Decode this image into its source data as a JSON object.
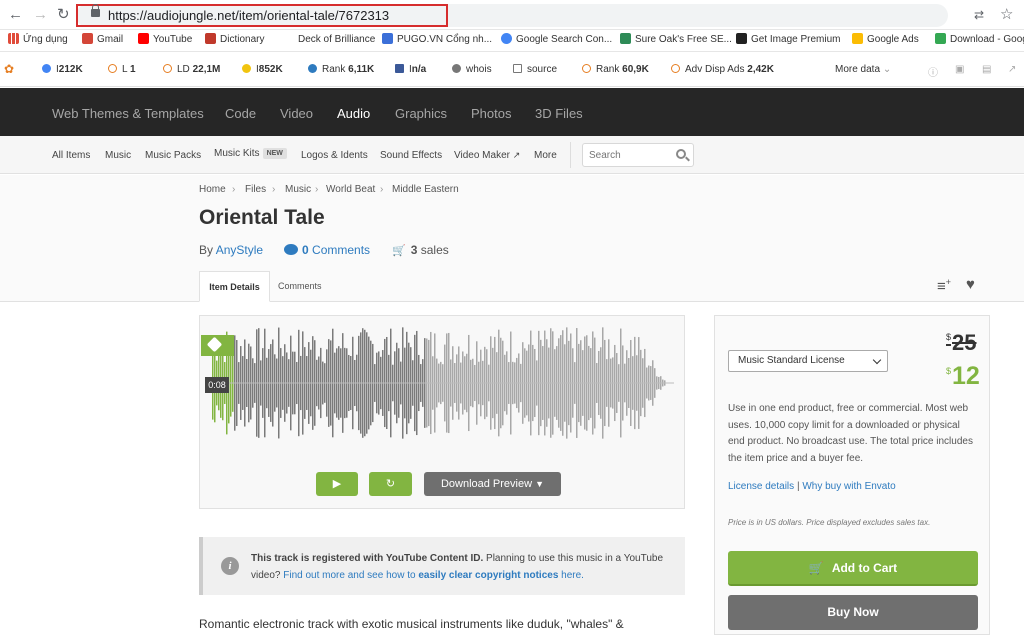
{
  "browser": {
    "url": "https://audiojungle.net/item/oriental-tale/7672313"
  },
  "bookmarks": [
    {
      "label": "Ứng dụng",
      "color": "#e04b3a"
    },
    {
      "label": "Gmail",
      "color": "#d44638"
    },
    {
      "label": "YouTube",
      "color": "#ff0000"
    },
    {
      "label": "Dictionary",
      "color": "#c0392b"
    },
    {
      "label": "Deck of Brilliance",
      "color": "#ffffff"
    },
    {
      "label": "PUGO.VN Cổng nh...",
      "color": "#3b6fd8"
    },
    {
      "label": "Google Search Con...",
      "color": "#4285f4"
    },
    {
      "label": "Sure Oak's Free SE...",
      "color": "#2e8b57"
    },
    {
      "label": "Get Image Premium",
      "color": "#222222"
    },
    {
      "label": "Google Ads",
      "color": "#fbbc04"
    },
    {
      "label": "Download - Goog",
      "color": "#34a853"
    }
  ],
  "seo_toolbar": [
    {
      "prefix": "I",
      "value": "212K",
      "color": "#4285f4"
    },
    {
      "prefix": "L",
      "value": "1",
      "color": "#e67e22"
    },
    {
      "prefix": "LD",
      "value": "22,1M",
      "color": "#e67e22"
    },
    {
      "prefix": "I",
      "value": "852K",
      "color": "#f1c40f"
    },
    {
      "prefix": "Rank",
      "value": "6,11K",
      "color": "#2e7bbf"
    },
    {
      "prefix": "I",
      "value": "n/a",
      "color": "#3b5998"
    },
    {
      "prefix": "whois",
      "value": "",
      "color": "#777777"
    },
    {
      "prefix": "source",
      "value": "",
      "color": "#777777"
    },
    {
      "prefix": "Rank",
      "value": "60,9K",
      "color": "#e67e22"
    },
    {
      "prefix": "Adv Disp Ads",
      "value": "2,42K",
      "color": "#e67e22"
    }
  ],
  "seo_more": "More data",
  "top_nav": [
    "Web Themes & Templates",
    "Code",
    "Video",
    "Audio",
    "Graphics",
    "Photos",
    "3D Files"
  ],
  "sub_nav": {
    "items": [
      "All Items",
      "Music",
      "Music Packs",
      "Music Kits",
      "Logos & Idents",
      "Sound Effects",
      "Video Maker",
      "More"
    ],
    "new_badge": "NEW",
    "search_placeholder": "Search"
  },
  "breadcrumb": [
    "Home",
    "Files",
    "Music",
    "World Beat",
    "Middle Eastern"
  ],
  "item": {
    "title": "Oriental Tale",
    "by": "By",
    "author": "AnyStyle",
    "comments_count": "0",
    "comments_label": "Comments",
    "sales_count": "3",
    "sales_label": "sales"
  },
  "tabs": [
    "Item Details",
    "Comments"
  ],
  "player": {
    "time": "0:08",
    "progress": 0.46,
    "download_label": "Download Preview"
  },
  "notice": {
    "bold": "This track is registered with YouTube Content ID.",
    "text": " Planning to use this music in a YouTube video? ",
    "link1": "Find out more and see how to ",
    "link_bold": "easily clear copyright notices",
    "link2": " here."
  },
  "description": "Romantic electronic track with exotic musical instruments like duduk, \"whales\" &",
  "license": {
    "selected": "Music Standard License",
    "currency_symbol": "$",
    "old_price": "25",
    "price": "12",
    "text": "Use in one end product, free or commercial. Most web uses. 10,000 copy limit for a downloaded or physical end product. No broadcast use. The total price includes the item price and a buyer fee.",
    "details_link": "License details",
    "why_link": "Why buy with Envato",
    "tax_note": "Price is in US dollars. Price displayed excludes sales tax.",
    "add_to_cart": "Add to Cart",
    "buy_now": "Buy Now"
  },
  "colors": {
    "brand_green": "#82b541",
    "dark_nav": "#262626",
    "link": "#2e7bbf"
  }
}
